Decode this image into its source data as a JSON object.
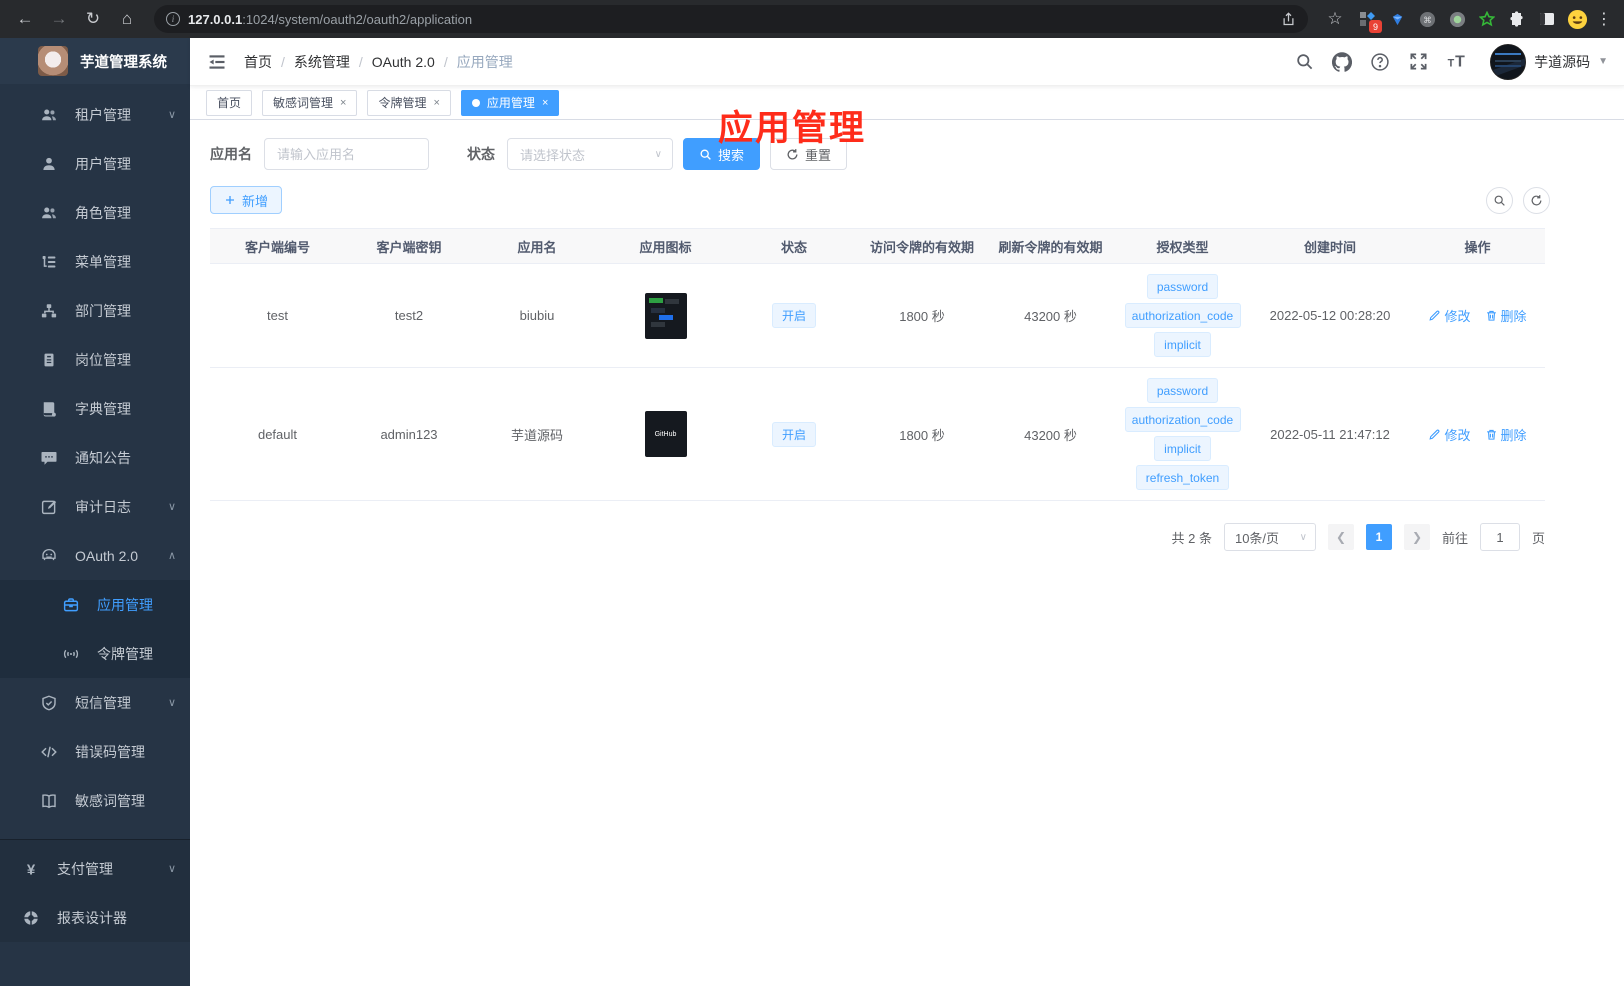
{
  "colors": {
    "accent": "#409eff",
    "annotation_red": "#fe2c1a",
    "sidebar_bg": "#263445",
    "tag_bg": "#ecf5ff"
  },
  "browser": {
    "url_host": "127.0.0.1",
    "url_path": ":1024/system/oauth2/oauth2/application",
    "extension_badge": "9"
  },
  "sidebar": {
    "title": "芋道管理系统",
    "items": [
      {
        "label": "租户管理",
        "icon": "tenant-users-icon",
        "arrow": "down",
        "level": 1
      },
      {
        "label": "用户管理",
        "icon": "user-icon",
        "level": 1
      },
      {
        "label": "角色管理",
        "icon": "roles-users-icon",
        "level": 1
      },
      {
        "label": "菜单管理",
        "icon": "menu-tree-icon",
        "level": 1
      },
      {
        "label": "部门管理",
        "icon": "department-icon",
        "level": 1
      },
      {
        "label": "岗位管理",
        "icon": "post-badge-icon",
        "level": 1
      },
      {
        "label": "字典管理",
        "icon": "dictionary-icon",
        "level": 1
      },
      {
        "label": "通知公告",
        "icon": "announcement-icon",
        "level": 1
      },
      {
        "label": "审计日志",
        "icon": "audit-log-icon",
        "arrow": "down",
        "level": 1
      },
      {
        "label": "OAuth 2.0",
        "icon": "oauth-robot-icon",
        "arrow": "up",
        "level": 1
      },
      {
        "label": "应用管理",
        "icon": "application-icon",
        "level": 2,
        "active": true
      },
      {
        "label": "令牌管理",
        "icon": "token-signal-icon",
        "level": 2
      },
      {
        "label": "短信管理",
        "icon": "sms-shield-icon",
        "arrow": "down",
        "level": 1
      },
      {
        "label": "错误码管理",
        "icon": "error-code-icon",
        "level": 1
      },
      {
        "label": "敏感词管理",
        "icon": "sensitive-word-book-icon",
        "level": 1
      },
      {
        "label": "支付管理",
        "icon": "pay-yen-icon",
        "arrow": "down",
        "level": 1,
        "section": "bottom"
      },
      {
        "label": "报表设计器",
        "icon": "report-designer-icon",
        "level": 1,
        "section": "bottom"
      }
    ]
  },
  "navbar": {
    "breadcrumb": [
      "首页",
      "系统管理",
      "OAuth 2.0",
      "应用管理"
    ],
    "username": "芋道源码"
  },
  "tabs": [
    {
      "label": "首页",
      "closable": false,
      "active": false
    },
    {
      "label": "敏感词管理",
      "closable": true,
      "active": false
    },
    {
      "label": "令牌管理",
      "closable": true,
      "active": false
    },
    {
      "label": "应用管理",
      "closable": true,
      "active": true
    }
  ],
  "annotation": {
    "text": "应用管理"
  },
  "filters": {
    "name_label": "应用名",
    "name_placeholder": "请输入应用名",
    "status_label": "状态",
    "status_placeholder": "请选择状态",
    "search_label": "搜索",
    "reset_label": "重置"
  },
  "toolbar": {
    "add_label": "新增"
  },
  "table": {
    "columns": [
      "客户端编号",
      "客户端密钥",
      "应用名",
      "应用图标",
      "状态",
      "访问令牌的有效期",
      "刷新令牌的有效期",
      "授权类型",
      "创建时间",
      "操作"
    ],
    "rows": [
      {
        "client_id": "test",
        "secret": "test2",
        "name": "biubiu",
        "icon_kind": "dark-screenshot",
        "icon_label": "",
        "status": "开启",
        "access_validity": "1800 秒",
        "refresh_validity": "43200 秒",
        "grant_types": [
          "password",
          "authorization_code",
          "implicit"
        ],
        "created_at": "2022-05-12 00:28:20"
      },
      {
        "client_id": "default",
        "secret": "admin123",
        "name": "芋道源码",
        "icon_kind": "github",
        "icon_label": "GitHub",
        "status": "开启",
        "access_validity": "1800 秒",
        "refresh_validity": "43200 秒",
        "grant_types": [
          "password",
          "authorization_code",
          "implicit",
          "refresh_token"
        ],
        "created_at": "2022-05-11 21:47:12"
      }
    ],
    "actions": {
      "edit": "修改",
      "delete": "删除"
    }
  },
  "pagination": {
    "total": "共 2 条",
    "page_size": "10条/页",
    "current_page": "1",
    "goto_label": "前往",
    "goto_value": "1",
    "unit_label": "页"
  }
}
